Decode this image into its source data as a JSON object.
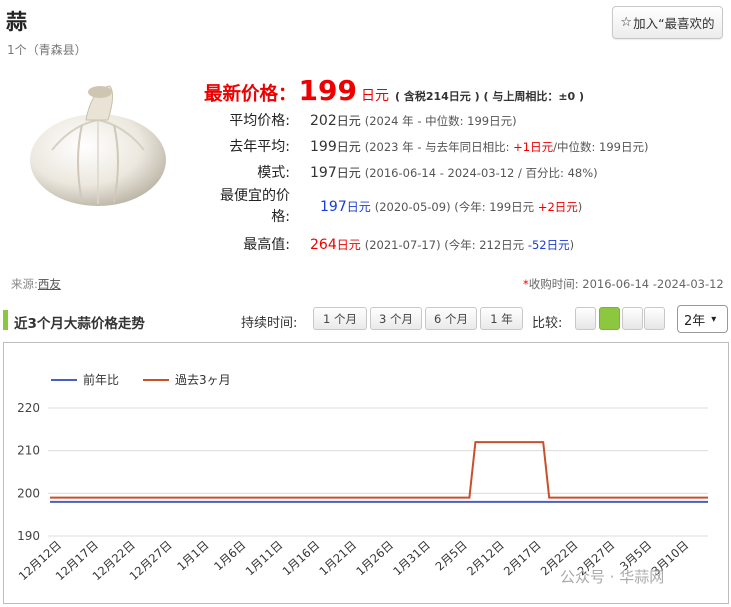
{
  "header": {
    "title": "蒜",
    "subtitle": "1个（青森县）",
    "fav_star": "☆",
    "fav_label": "加入“最喜欢的"
  },
  "price": {
    "latest_label": "最新价格：",
    "latest_value": "199",
    "latest_unit": "日元",
    "latest_note": "( 含税214日元 ) ( 与上周相比：±0 )",
    "rows": [
      {
        "label": "平均价格:",
        "value": "202",
        "unit": "日元",
        "note": "(2024 年 - 中位数:  199日元)"
      },
      {
        "label": "去年平均:",
        "value": "199",
        "unit": "日元",
        "note_pre": "(2023 年 - 与去年同日相比: ",
        "note_delta": "+1日元",
        "note_post": "/中位数:  199日元)"
      },
      {
        "label": "模式:",
        "value": "197",
        "unit": "日元",
        "note": "(2016-06-14 - 2024-03-12 / 百分比: 48%)"
      },
      {
        "label1": "最便宜的价",
        "label2": "格:",
        "value": "197",
        "unit": "日元",
        "note_pre": "(2020-05-09)  (今年:  199日元 ",
        "note_delta": "+2日元",
        "note_post": ")"
      },
      {
        "label": "最高值:",
        "value": "264",
        "unit": "日元",
        "note_pre": "(2021-07-17)  (今年:  212日元 ",
        "note_delta": "-52日元",
        "note_post": ")"
      }
    ]
  },
  "source": {
    "label": "来源:",
    "link": "西友"
  },
  "collection_period": {
    "star": "*",
    "text": "收购时间: 2016-06-14 -2024-03-12"
  },
  "trend": {
    "section_title": "近3个月大蒜价格走势",
    "duration_label": "持续时间:",
    "duration_buttons": [
      "1 个月",
      "3 个月",
      "6 个月",
      "1 年"
    ],
    "compare_label": "比较:",
    "compare_selected_index": 1,
    "range_select": "2年",
    "range_chevron": "▾"
  },
  "watermark": "公众号 · 华蒜网",
  "chart_data": {
    "type": "line",
    "x": [
      "12月12日",
      "12月17日",
      "12月22日",
      "12月27日",
      "1月1日",
      "1月6日",
      "1月11日",
      "1月16日",
      "1月21日",
      "1月26日",
      "1月31日",
      "2月5日",
      "2月12日",
      "2月17日",
      "2月22日",
      "2月27日",
      "3月5日",
      "3月10日"
    ],
    "series": [
      {
        "name": "前年比",
        "color": "#4a5fc1",
        "values": [
          198,
          198,
          198,
          198,
          198,
          198,
          198,
          198,
          198,
          198,
          198,
          198,
          198,
          198,
          198,
          198,
          198,
          198
        ]
      },
      {
        "name": "過去3ヶ月",
        "color": "#c8502a",
        "values": [
          199,
          199,
          199,
          199,
          199,
          199,
          199,
          199,
          199,
          199,
          199,
          199,
          212,
          212,
          199,
          199,
          199,
          199
        ]
      }
    ],
    "yticks": [
      190,
      200,
      210,
      220
    ],
    "ylim": [
      190,
      220
    ],
    "grid": true,
    "legend_position": "top-left"
  }
}
